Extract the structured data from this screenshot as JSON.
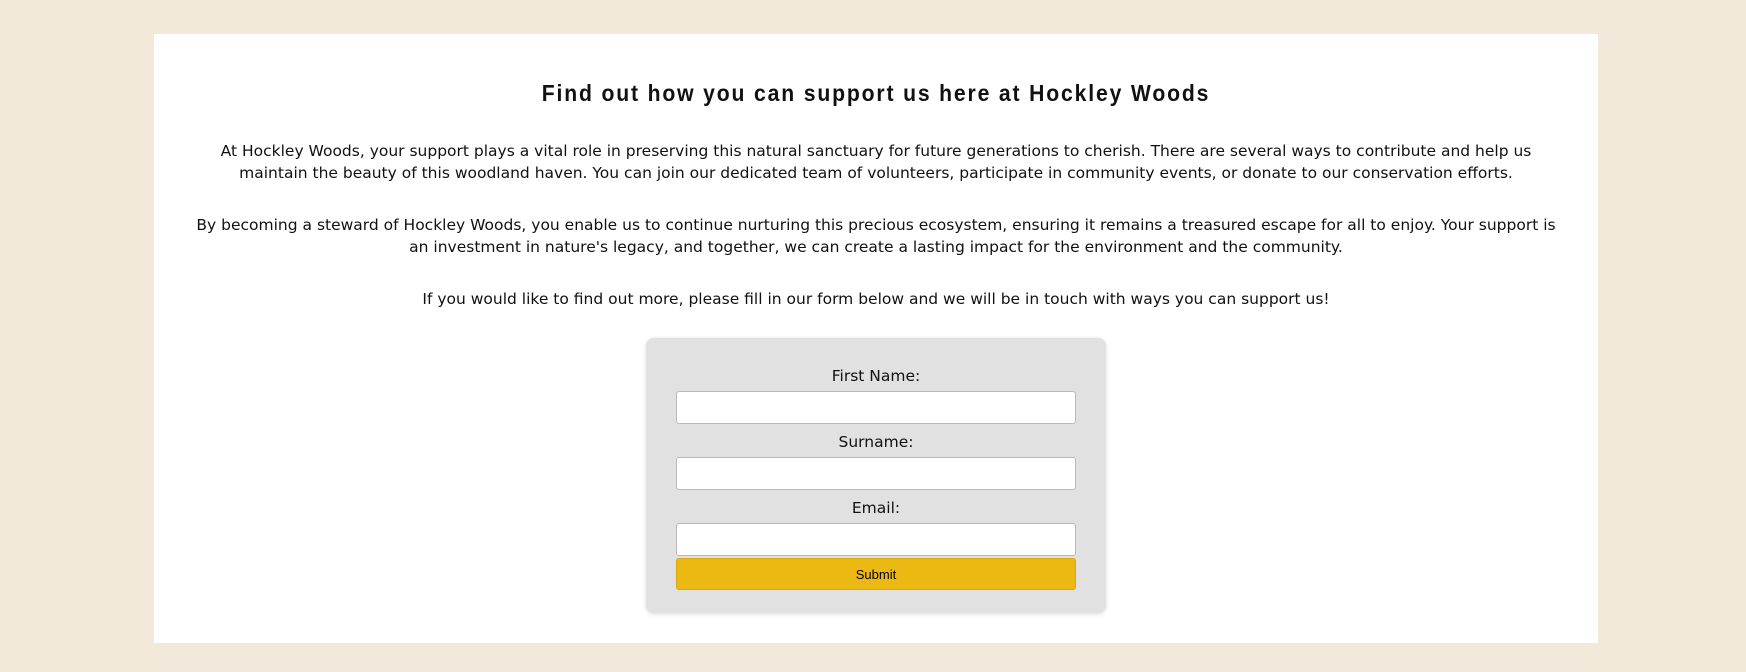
{
  "main": {
    "title": "Find out how you can support us here at Hockley Woods",
    "paragraphs": [
      "At Hockley Woods, your support plays a vital role in preserving this natural sanctuary for future generations to cherish. There are several ways to contribute and help us maintain the beauty of this woodland haven. You can join our dedicated team of volunteers, participate in community events, or donate to our conservation efforts.",
      "By becoming a steward of Hockley Woods, you enable us to continue nurturing this precious ecosystem, ensuring it remains a treasured escape for all to enjoy. Your support is an investment in nature's legacy, and together, we can create a lasting impact for the environment and the community.",
      "If you would like to find out more, please fill in our form below and we will be in touch with ways you can support us!"
    ]
  },
  "form": {
    "first_name_label": "First Name:",
    "first_name_value": "",
    "surname_label": "Surname:",
    "surname_value": "",
    "email_label": "Email:",
    "email_value": "",
    "submit_label": "Submit"
  },
  "colors": {
    "page_background": "#f3e9da",
    "card_background": "#ffffff",
    "form_background": "#e1e1e1",
    "submit_accent": "#ecb912"
  }
}
